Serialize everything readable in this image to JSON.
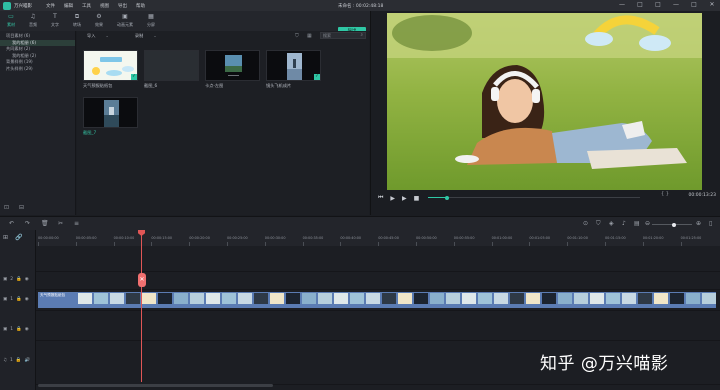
{
  "app": {
    "name": "万兴喵影",
    "menu": [
      "文件",
      "编辑",
      "工具",
      "视图",
      "导出",
      "帮助"
    ],
    "project_title": "未命名 : 00:02:48:18",
    "window_controls": [
      "—",
      "□",
      "□",
      "—",
      "□",
      "✕"
    ]
  },
  "tool_tabs": [
    {
      "label": "素材",
      "icon": "folder-icon",
      "glyph": "▭",
      "active": true
    },
    {
      "label": "音频",
      "icon": "music-icon",
      "glyph": "♫",
      "active": false
    },
    {
      "label": "文字",
      "icon": "text-icon",
      "glyph": "T",
      "active": false
    },
    {
      "label": "转场",
      "icon": "transition-icon",
      "glyph": "⧉",
      "active": false
    },
    {
      "label": "效果",
      "icon": "effects-icon",
      "glyph": "⚙",
      "active": false
    },
    {
      "label": "动画元素",
      "icon": "elements-icon",
      "glyph": "▣",
      "active": false
    },
    {
      "label": "分屏",
      "icon": "split-screen-icon",
      "glyph": "▦",
      "active": false
    }
  ],
  "export_label": "导出",
  "tree": [
    {
      "label": "项目素材 (6)",
      "sub": false,
      "selected": false
    },
    {
      "label": "我的相册 (6)",
      "sub": true,
      "selected": true
    },
    {
      "label": "共同素材 (2)",
      "sub": false,
      "selected": false
    },
    {
      "label": "我的相册 (2)",
      "sub": true,
      "selected": false
    },
    {
      "label": "背景样例 (19)",
      "sub": false,
      "selected": false
    },
    {
      "label": "片头样例 (29)",
      "sub": false,
      "selected": false
    }
  ],
  "media_toolbar": {
    "import_label": "导入",
    "record_label": "录制",
    "search_placeholder": "搜索"
  },
  "media_clips": [
    {
      "label": "天气预报贴纸包",
      "teal": false,
      "checked": true
    },
    {
      "label": "截图_6",
      "teal": false,
      "checked": false
    },
    {
      "label": "卡点-左图",
      "teal": false,
      "checked": false
    },
    {
      "label": "镜头飞机成片",
      "teal": false,
      "checked": true
    },
    {
      "label": "截图_7",
      "teal": true,
      "checked": false
    }
  ],
  "preview": {
    "timecode": "00:00:13:23",
    "progress": 0.09,
    "controls": [
      "⏮",
      "▶",
      "▶",
      "■"
    ]
  },
  "timeline": {
    "ruler_labels": [
      "00:00:00:00",
      "00:00:05:00",
      "00:00:10:00",
      "00:00:15:00",
      "00:00:20:00",
      "00:00:25:00",
      "00:00:30:00",
      "00:00:35:00",
      "00:00:40:00",
      "00:00:45:00",
      "00:00:50:00",
      "00:00:55:00",
      "00:01:00:00",
      "00:01:05:00",
      "00:01:10:00",
      "00:01:15:00",
      "00:01:20:00",
      "00:01:25:00"
    ],
    "clip_title": "天气预报贴纸包",
    "track_labels": [
      "2",
      "1",
      "1",
      "1"
    ],
    "zoom_level": 0.55
  },
  "watermark": "知乎 @万兴喵影",
  "colors": {
    "accent": "#2fc7a5",
    "playhead": "#e05656",
    "clip": "#5b7cb3"
  }
}
